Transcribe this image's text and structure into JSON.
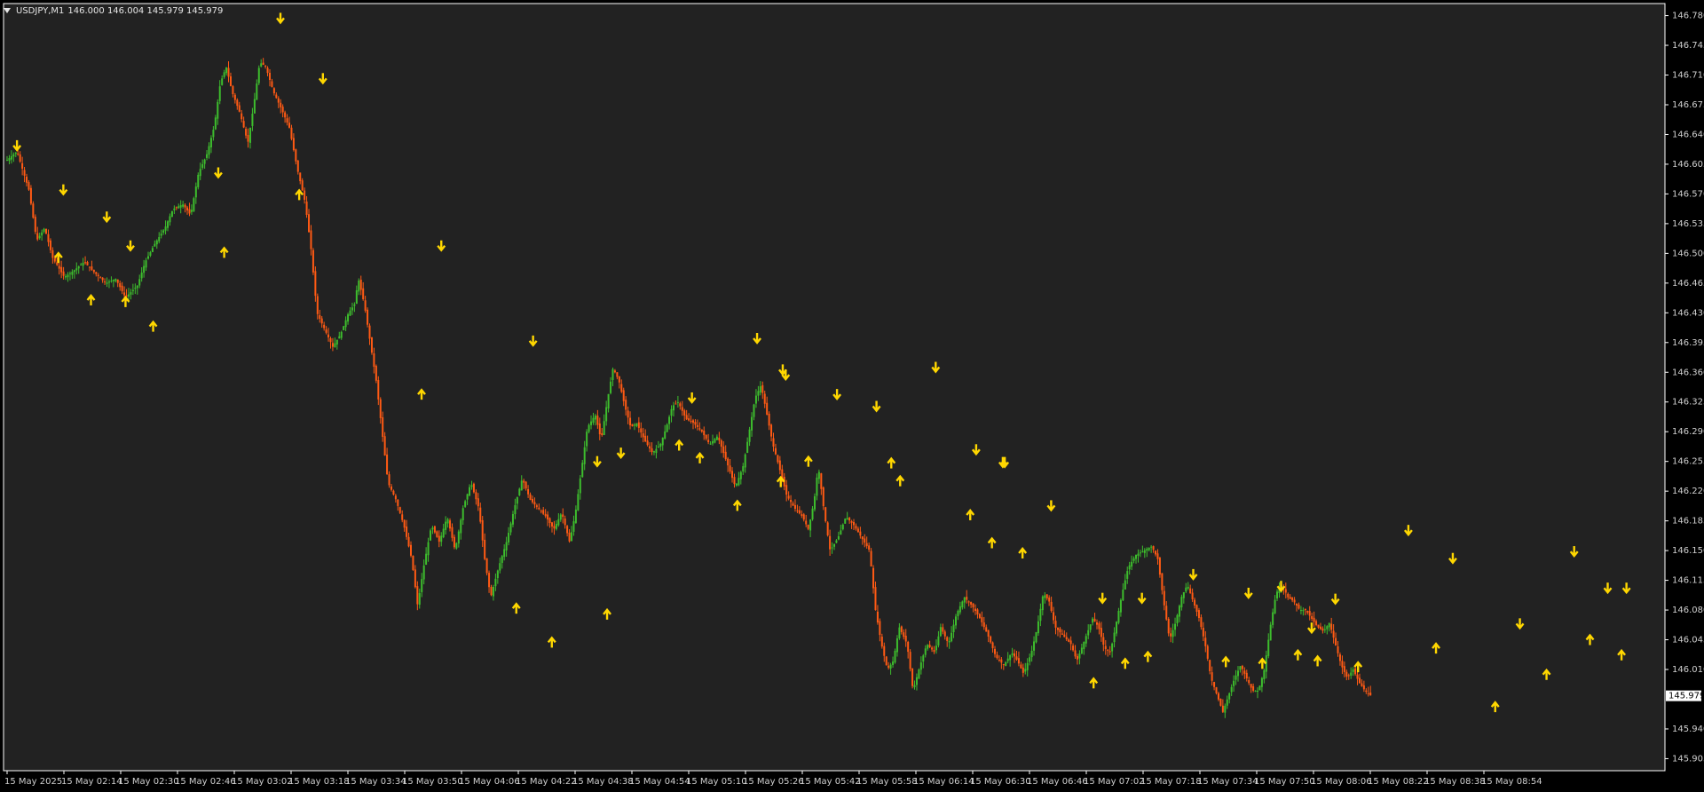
{
  "header": {
    "symbol_label": "USDJPY,M1",
    "ohlc_label": "146.000 146.004 145.979 145.979"
  },
  "colors": {
    "background": "#222222",
    "frame": "#ffffff",
    "bull": "#3dbd2d",
    "bear": "#ff5a14",
    "arrow": "#ffd700",
    "text": "#d0d0d0"
  },
  "current_price": "145.979",
  "price_axis": {
    "ticks": [
      "146.780",
      "146.745",
      "146.710",
      "146.675",
      "146.640",
      "146.605",
      "146.570",
      "146.535",
      "146.500",
      "146.465",
      "146.430",
      "146.395",
      "146.360",
      "146.325",
      "146.290",
      "146.255",
      "146.220",
      "146.185",
      "146.150",
      "146.115",
      "146.080",
      "146.045",
      "146.010",
      "145.940",
      "145.905"
    ]
  },
  "time_axis": {
    "ticks": [
      "15 May 2025",
      "15 May 02:14",
      "15 May 02:30",
      "15 May 02:46",
      "15 May 03:02",
      "15 May 03:18",
      "15 May 03:34",
      "15 May 03:50",
      "15 May 04:06",
      "15 May 04:22",
      "15 May 04:38",
      "15 May 04:54",
      "15 May 05:10",
      "15 May 05:26",
      "15 May 05:42",
      "15 May 05:58",
      "15 May 06:14",
      "15 May 06:30",
      "15 May 06:46",
      "15 May 07:02",
      "15 May 07:18",
      "15 May 07:34",
      "15 May 07:50",
      "15 May 08:06",
      "15 May 08:22",
      "15 May 08:38",
      "15 May 08:54"
    ]
  },
  "chart_data": {
    "type": "candlestick",
    "symbol": "USDJPY",
    "timeframe": "M1",
    "ylim": [
      145.895,
      146.79
    ],
    "path": [
      [
        0,
        146.61
      ],
      [
        10,
        146.62
      ],
      [
        22,
        146.575
      ],
      [
        30,
        146.515
      ],
      [
        38,
        146.53
      ],
      [
        46,
        146.495
      ],
      [
        58,
        146.472
      ],
      [
        68,
        146.48
      ],
      [
        78,
        146.49
      ],
      [
        88,
        146.478
      ],
      [
        100,
        146.465
      ],
      [
        110,
        146.47
      ],
      [
        120,
        146.448
      ],
      [
        132,
        146.462
      ],
      [
        140,
        146.49
      ],
      [
        150,
        146.512
      ],
      [
        160,
        146.53
      ],
      [
        168,
        146.552
      ],
      [
        178,
        146.558
      ],
      [
        186,
        146.545
      ],
      [
        194,
        146.595
      ],
      [
        202,
        146.615
      ],
      [
        210,
        146.65
      ],
      [
        216,
        146.7
      ],
      [
        222,
        146.72
      ],
      [
        228,
        146.69
      ],
      [
        236,
        146.665
      ],
      [
        244,
        146.63
      ],
      [
        250,
        146.675
      ],
      [
        256,
        146.725
      ],
      [
        262,
        146.72
      ],
      [
        270,
        146.69
      ],
      [
        278,
        146.67
      ],
      [
        286,
        146.648
      ],
      [
        294,
        146.6
      ],
      [
        302,
        146.56
      ],
      [
        308,
        146.505
      ],
      [
        314,
        146.43
      ],
      [
        322,
        146.41
      ],
      [
        330,
        146.39
      ],
      [
        338,
        146.405
      ],
      [
        346,
        146.43
      ],
      [
        352,
        146.44
      ],
      [
        356,
        146.47
      ],
      [
        362,
        146.44
      ],
      [
        368,
        146.395
      ],
      [
        374,
        146.35
      ],
      [
        380,
        146.29
      ],
      [
        386,
        146.23
      ],
      [
        394,
        146.21
      ],
      [
        402,
        146.18
      ],
      [
        410,
        146.14
      ],
      [
        416,
        146.085
      ],
      [
        422,
        146.13
      ],
      [
        430,
        146.18
      ],
      [
        438,
        146.16
      ],
      [
        446,
        146.19
      ],
      [
        454,
        146.15
      ],
      [
        462,
        146.2
      ],
      [
        470,
        146.23
      ],
      [
        478,
        146.2
      ],
      [
        484,
        146.14
      ],
      [
        490,
        146.095
      ],
      [
        498,
        146.13
      ],
      [
        506,
        146.16
      ],
      [
        514,
        146.2
      ],
      [
        522,
        146.235
      ],
      [
        530,
        146.21
      ],
      [
        538,
        146.2
      ],
      [
        546,
        146.19
      ],
      [
        554,
        146.175
      ],
      [
        562,
        146.195
      ],
      [
        570,
        146.16
      ],
      [
        576,
        146.195
      ],
      [
        582,
        146.245
      ],
      [
        588,
        146.295
      ],
      [
        596,
        146.31
      ],
      [
        602,
        146.28
      ],
      [
        608,
        146.325
      ],
      [
        614,
        146.365
      ],
      [
        620,
        146.35
      ],
      [
        626,
        146.32
      ],
      [
        632,
        146.295
      ],
      [
        638,
        146.3
      ],
      [
        646,
        146.28
      ],
      [
        654,
        146.265
      ],
      [
        662,
        146.275
      ],
      [
        668,
        146.295
      ],
      [
        674,
        146.32
      ],
      [
        680,
        146.325
      ],
      [
        688,
        146.305
      ],
      [
        696,
        146.3
      ],
      [
        704,
        146.29
      ],
      [
        712,
        146.275
      ],
      [
        720,
        146.285
      ],
      [
        726,
        146.265
      ],
      [
        732,
        146.245
      ],
      [
        738,
        146.225
      ],
      [
        746,
        146.25
      ],
      [
        752,
        146.29
      ],
      [
        758,
        146.33
      ],
      [
        764,
        146.345
      ],
      [
        770,
        146.31
      ],
      [
        776,
        146.275
      ],
      [
        782,
        146.25
      ],
      [
        790,
        146.215
      ],
      [
        798,
        146.2
      ],
      [
        806,
        146.19
      ],
      [
        812,
        146.175
      ],
      [
        818,
        146.21
      ],
      [
        822,
        146.25
      ],
      [
        828,
        146.195
      ],
      [
        834,
        146.15
      ],
      [
        842,
        146.165
      ],
      [
        850,
        146.19
      ],
      [
        858,
        146.18
      ],
      [
        866,
        146.165
      ],
      [
        874,
        146.15
      ],
      [
        880,
        146.08
      ],
      [
        886,
        146.04
      ],
      [
        892,
        146.01
      ],
      [
        898,
        146.02
      ],
      [
        904,
        146.06
      ],
      [
        912,
        146.04
      ],
      [
        918,
        145.985
      ],
      [
        924,
        146.01
      ],
      [
        932,
        146.04
      ],
      [
        940,
        146.03
      ],
      [
        946,
        146.06
      ],
      [
        954,
        146.04
      ],
      [
        962,
        146.075
      ],
      [
        970,
        146.095
      ],
      [
        978,
        146.085
      ],
      [
        986,
        146.07
      ],
      [
        994,
        146.05
      ],
      [
        1002,
        146.025
      ],
      [
        1010,
        146.015
      ],
      [
        1018,
        146.03
      ],
      [
        1024,
        146.02
      ],
      [
        1030,
        146.005
      ],
      [
        1038,
        146.03
      ],
      [
        1044,
        146.06
      ],
      [
        1050,
        146.1
      ],
      [
        1056,
        146.09
      ],
      [
        1062,
        146.06
      ],
      [
        1070,
        146.05
      ],
      [
        1078,
        146.04
      ],
      [
        1084,
        146.02
      ],
      [
        1092,
        146.045
      ],
      [
        1100,
        146.07
      ],
      [
        1106,
        146.06
      ],
      [
        1112,
        146.035
      ],
      [
        1118,
        146.03
      ],
      [
        1124,
        146.065
      ],
      [
        1130,
        146.1
      ],
      [
        1136,
        146.13
      ],
      [
        1144,
        146.145
      ],
      [
        1152,
        146.15
      ],
      [
        1160,
        146.155
      ],
      [
        1166,
        146.14
      ],
      [
        1172,
        146.09
      ],
      [
        1178,
        146.045
      ],
      [
        1184,
        146.065
      ],
      [
        1190,
        146.095
      ],
      [
        1196,
        146.11
      ],
      [
        1202,
        146.09
      ],
      [
        1208,
        146.07
      ],
      [
        1214,
        146.04
      ],
      [
        1220,
        146.0
      ],
      [
        1226,
        145.98
      ],
      [
        1232,
        145.96
      ],
      [
        1238,
        145.98
      ],
      [
        1244,
        146.0
      ],
      [
        1250,
        146.015
      ],
      [
        1256,
        146.0
      ],
      [
        1262,
        145.985
      ],
      [
        1268,
        145.985
      ],
      [
        1274,
        146.01
      ],
      [
        1280,
        146.06
      ],
      [
        1286,
        146.1
      ],
      [
        1292,
        146.11
      ],
      [
        1298,
        146.095
      ],
      [
        1304,
        146.09
      ],
      [
        1310,
        146.08
      ],
      [
        1316,
        146.08
      ],
      [
        1322,
        146.07
      ],
      [
        1328,
        146.06
      ],
      [
        1334,
        146.055
      ],
      [
        1340,
        146.065
      ],
      [
        1346,
        146.04
      ],
      [
        1352,
        146.015
      ],
      [
        1358,
        146.0
      ],
      [
        1364,
        146.01
      ],
      [
        1370,
        145.995
      ],
      [
        1376,
        145.985
      ],
      [
        1382,
        145.979
      ]
    ],
    "arrows_down": [
      [
        10,
        146.627
      ],
      [
        57,
        146.575
      ],
      [
        101,
        146.543
      ],
      [
        125,
        146.509
      ],
      [
        214,
        146.595
      ],
      [
        277,
        146.777
      ],
      [
        320,
        146.706
      ],
      [
        440,
        146.509
      ],
      [
        533,
        146.397
      ],
      [
        598,
        146.255
      ],
      [
        622,
        146.265
      ],
      [
        694,
        146.33
      ],
      [
        760,
        146.4
      ],
      [
        786,
        146.363
      ],
      [
        789,
        146.357
      ],
      [
        841,
        146.334
      ],
      [
        881,
        146.32
      ],
      [
        941,
        146.366
      ],
      [
        982,
        146.269
      ],
      [
        1011,
        146.254
      ],
      [
        1009,
        146.254
      ],
      [
        1058,
        146.203
      ],
      [
        1110,
        146.094
      ],
      [
        1150,
        146.094
      ],
      [
        1202,
        146.122
      ],
      [
        1258,
        146.1
      ],
      [
        1291,
        146.108
      ],
      [
        1322,
        146.059
      ],
      [
        1346,
        146.093
      ],
      [
        1420,
        146.174
      ],
      [
        1465,
        146.141
      ],
      [
        1533,
        146.064
      ],
      [
        1588,
        146.149
      ],
      [
        1622,
        146.106
      ],
      [
        1641,
        146.106
      ]
    ],
    "arrows_up": [
      [
        52,
        146.495
      ],
      [
        85,
        146.445
      ],
      [
        120,
        146.443
      ],
      [
        148,
        146.414
      ],
      [
        220,
        146.501
      ],
      [
        296,
        146.569
      ],
      [
        420,
        146.334
      ],
      [
        516,
        146.082
      ],
      [
        552,
        146.042
      ],
      [
        608,
        146.075
      ],
      [
        681,
        146.274
      ],
      [
        702,
        146.259
      ],
      [
        740,
        146.203
      ],
      [
        784,
        146.231
      ],
      [
        812,
        146.255
      ],
      [
        896,
        146.253
      ],
      [
        905,
        146.232
      ],
      [
        976,
        146.192
      ],
      [
        998,
        146.159
      ],
      [
        1029,
        146.147
      ],
      [
        1101,
        145.994
      ],
      [
        1133,
        146.017
      ],
      [
        1156,
        146.025
      ],
      [
        1235,
        146.019
      ],
      [
        1272,
        146.017
      ],
      [
        1308,
        146.027
      ],
      [
        1328,
        146.02
      ],
      [
        1369,
        146.013
      ],
      [
        1448,
        146.035
      ],
      [
        1508,
        145.966
      ],
      [
        1560,
        146.004
      ],
      [
        1604,
        146.045
      ],
      [
        1636,
        146.027
      ]
    ]
  }
}
